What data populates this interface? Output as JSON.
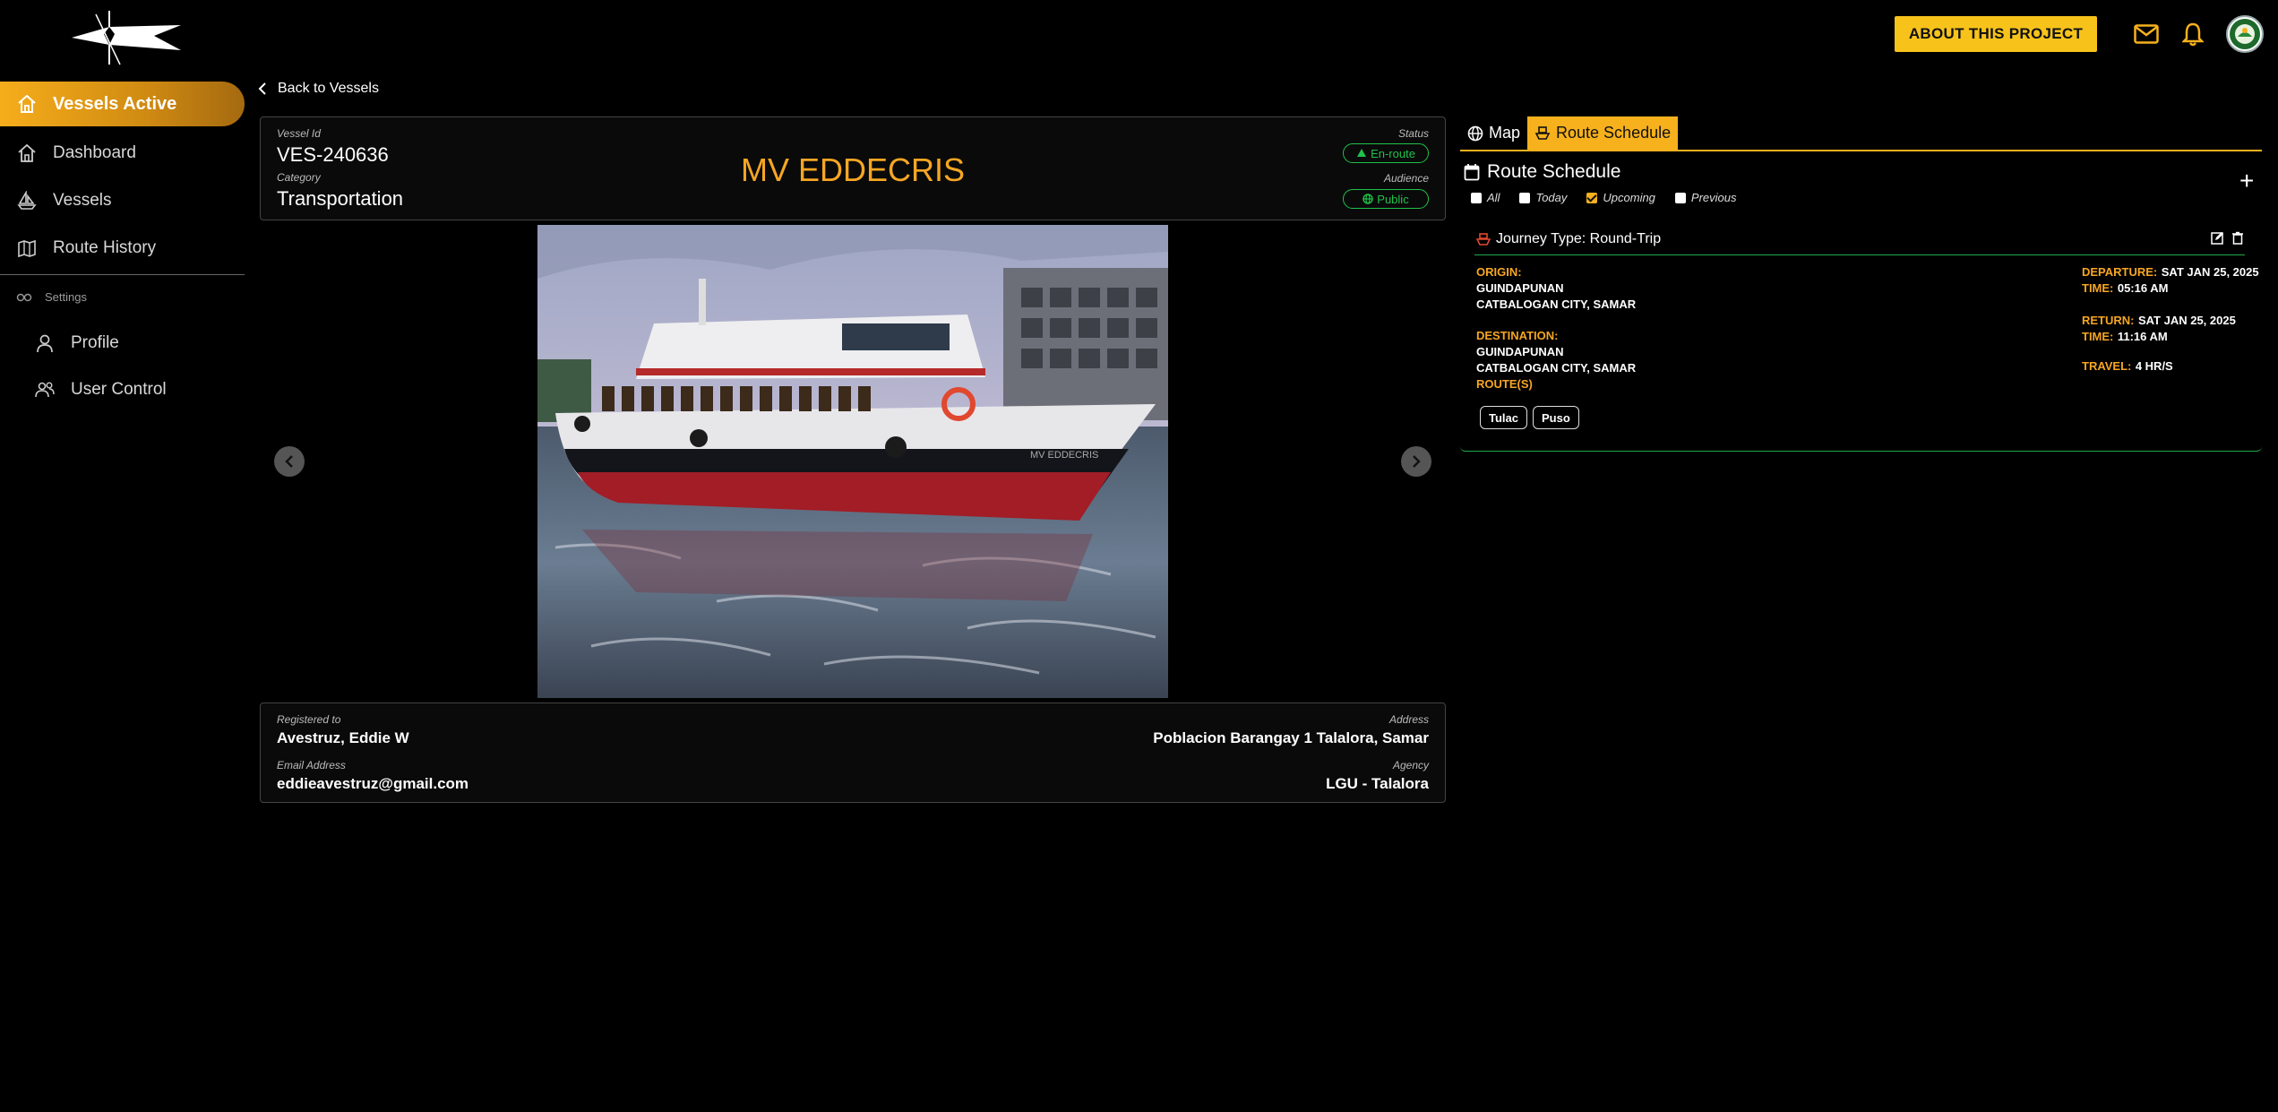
{
  "header": {
    "about_label": "ABOUT THIS PROJECT",
    "icons": [
      "mail-icon",
      "bell-icon",
      "avatar"
    ]
  },
  "sidebar": {
    "active": {
      "label": "Vessels Active",
      "icon": "home-icon"
    },
    "items": [
      {
        "label": "Dashboard",
        "icon": "home-icon"
      },
      {
        "label": "Vessels",
        "icon": "ship-icon"
      },
      {
        "label": "Route History",
        "icon": "map-icon"
      }
    ],
    "settings_label": "Settings",
    "settings_items": [
      {
        "label": "Profile",
        "icon": "user-icon"
      },
      {
        "label": "User Control",
        "icon": "users-icon"
      }
    ]
  },
  "main": {
    "back_label": "Back to Vessels",
    "vessel": {
      "id_label": "Vessel Id",
      "id": "VES-240636",
      "category_label": "Category",
      "category": "Transportation",
      "name": "MV EDDECRIS",
      "status_label": "Status",
      "status": "En-route",
      "audience_label": "Audience",
      "audience": "Public"
    },
    "photo_hull_text": "MV EDDECRIS",
    "owner": {
      "registered_label": "Registered to",
      "registered": "Avestruz, Eddie W",
      "email_label": "Email Address",
      "email": "eddieavestruz@gmail.com",
      "address_label": "Address",
      "address": "Poblacion Barangay 1 Talalora, Samar",
      "agency_label": "Agency",
      "agency": "LGU - Talalora"
    }
  },
  "panel": {
    "tabs": [
      {
        "label": "Map",
        "icon": "globe-icon"
      },
      {
        "label": "Route Schedule",
        "icon": "ship-icon",
        "active": true
      }
    ],
    "title": "Route Schedule",
    "filters": [
      {
        "label": "All",
        "checked": false
      },
      {
        "label": "Today",
        "checked": false
      },
      {
        "label": "Upcoming",
        "checked": true
      },
      {
        "label": "Previous",
        "checked": false
      }
    ],
    "journey": {
      "type": "Journey Type: Round-Trip",
      "origin_label": "ORIGIN:",
      "origin_1": "GUINDAPUNAN",
      "origin_2": "CATBALOGAN CITY, SAMAR",
      "destination_label": "DESTINATION:",
      "destination_1": "GUINDAPUNAN",
      "destination_2": "CATBALOGAN CITY, SAMAR",
      "routes_label": "ROUTE(S)",
      "routes": [
        "Tulac",
        "Puso"
      ],
      "departure_label": "DEPARTURE:",
      "departure": "SAT JAN 25, 2025",
      "dep_time_label": "TIME:",
      "dep_time": "05:16 AM",
      "return_label": "RETURN:",
      "return": "SAT JAN 25, 2025",
      "ret_time_label": "TIME:",
      "ret_time": "11:16 AM",
      "travel_label": "TRAVEL:",
      "travel": "4 HR/S"
    }
  },
  "colors": {
    "accent": "#f6b11d",
    "status": "#1fc24a",
    "name": "#f6a623"
  }
}
